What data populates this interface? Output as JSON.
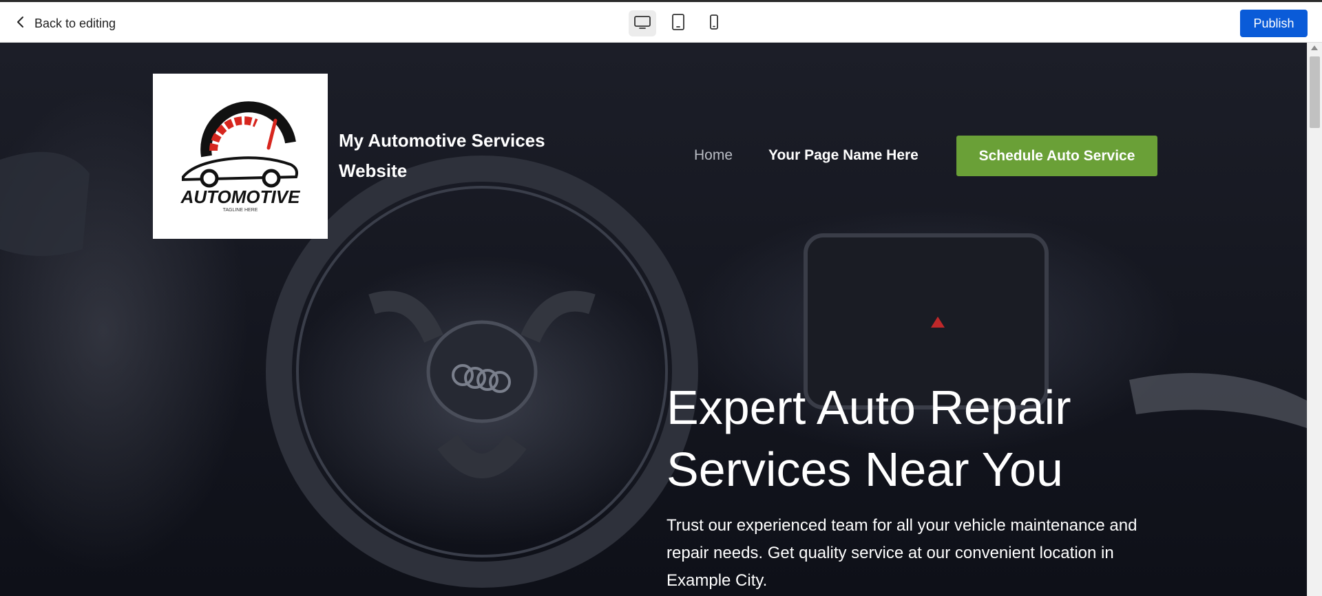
{
  "toolbar": {
    "back_label": "Back to editing",
    "back_icon": "chevron-left-icon",
    "devices": [
      {
        "name": "desktop",
        "icon": "monitor-icon",
        "active": true
      },
      {
        "name": "tablet",
        "icon": "tablet-icon",
        "active": false
      },
      {
        "name": "mobile",
        "icon": "smartphone-icon",
        "active": false
      }
    ],
    "publish_label": "Publish",
    "publish_color": "#0a5bd8"
  },
  "site": {
    "logo": {
      "brand_text": "AUTOMOTIVE",
      "tagline": "TAGLINE HERE",
      "accent_color": "#d7261e"
    },
    "title": "My Automotive Services Website",
    "nav": {
      "home_label": "Home",
      "page_label": "Your Page Name Here"
    },
    "cta_label": "Schedule Auto Service",
    "cta_color": "#6aa037"
  },
  "hero": {
    "title_line1": "Expert Auto Repair",
    "title_line2": "Services Near You",
    "subtitle": "Trust our experienced team for all your vehicle maintenance and repair needs. Get quality service at our convenient location in Example City."
  }
}
